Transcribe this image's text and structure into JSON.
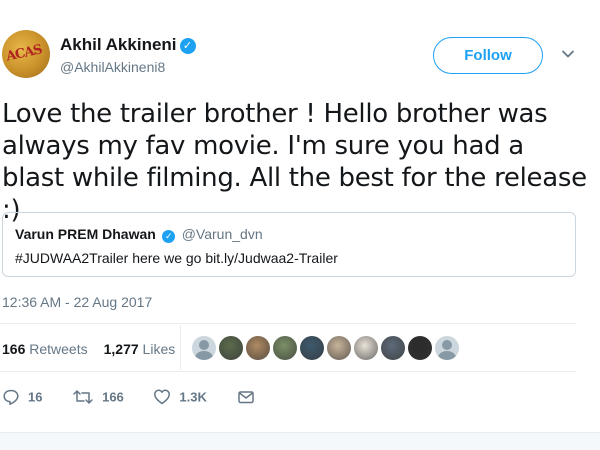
{
  "author": {
    "name": "Akhil Akkineni",
    "handle": "@AkhilAkkineni8",
    "avatar_text": "ACAS",
    "verified": true
  },
  "follow_button": "Follow",
  "tweet": {
    "text": "Love the trailer brother ! Hello brother was always my fav movie. I'm sure you had a blast while filming. All the best for the release :)",
    "timestamp": "12:36 AM - 22 Aug 2017"
  },
  "quote": {
    "name": "Varun PREM Dhawan",
    "handle": "@Varun_dvn",
    "text": "#JUDWAA2Trailer here we go bit.ly/Judwaa2-Trailer"
  },
  "stats": {
    "retweets_count": "166",
    "retweets_label": "Retweets",
    "likes_count": "1,277",
    "likes_label": "Likes"
  },
  "likers": [
    {
      "icon": "default-avatar"
    },
    {
      "color": "#5b6b4c"
    },
    {
      "color": "#b08a62"
    },
    {
      "color": "#7b8f67"
    },
    {
      "color": "#3e5a6e"
    },
    {
      "color": "#c9b49a"
    },
    {
      "color": "#e9e2d8"
    },
    {
      "color": "#5d6a78"
    },
    {
      "color": "#2b2b2b"
    },
    {
      "icon": "default-avatar"
    }
  ],
  "actions": {
    "reply": "16",
    "retweet": "166",
    "like": "1.3K"
  },
  "colors": {
    "accent": "#1da1f2",
    "muted": "#657786",
    "border": "#e6ecf0"
  }
}
